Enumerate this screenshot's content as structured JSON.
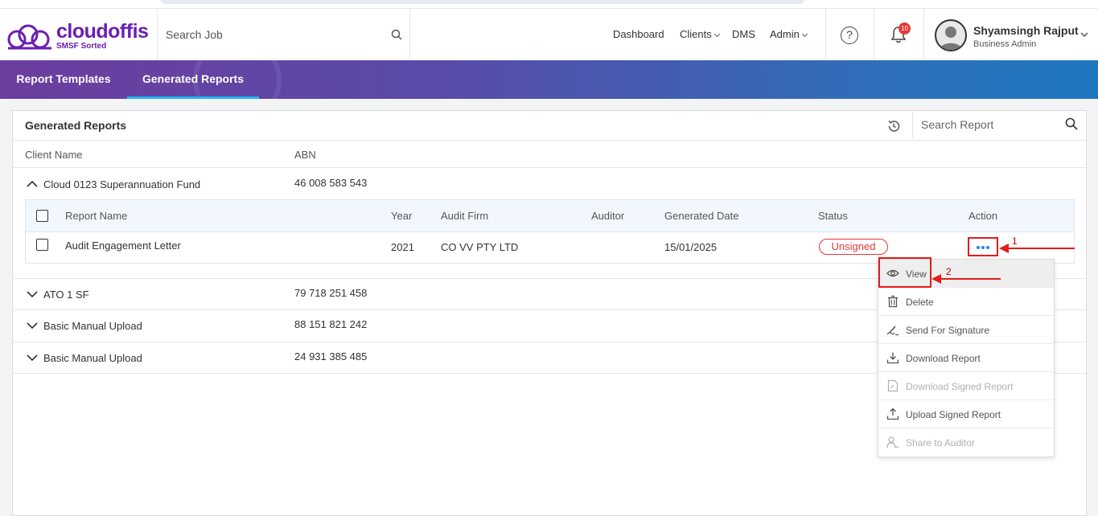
{
  "brand": {
    "name": "cloudoffis",
    "tagline": "SMSF Sorted",
    "color": "#6a1fb0"
  },
  "header": {
    "search_placeholder": "Search Job",
    "nav": [
      "Dashboard",
      "Clients",
      "DMS",
      "Admin"
    ],
    "notifications_count": "10",
    "user_name": "Shyamsingh Rajput",
    "user_role": "Business Admin"
  },
  "tabs": [
    {
      "label": "Report Templates",
      "active": false
    },
    {
      "label": "Generated Reports",
      "active": true
    }
  ],
  "panel": {
    "title": "Generated Reports",
    "search_placeholder": "Search Report",
    "columns": [
      "Client Name",
      "ABN"
    ],
    "clients": [
      {
        "name": "Cloud 0123 Superannuation Fund",
        "abn": "46 008 583 543",
        "expanded": true
      },
      {
        "name": "ATO 1 SF",
        "abn": "79 718 251 458",
        "expanded": false
      },
      {
        "name": "Basic Manual Upload",
        "abn": "88 151 821 242",
        "expanded": false
      },
      {
        "name": "Basic Manual Upload",
        "abn": "24 931 385 485",
        "expanded": false
      }
    ],
    "report_columns": [
      "Report Name",
      "Year",
      "Audit Firm",
      "Auditor",
      "Generated Date",
      "Status",
      "Action"
    ],
    "report_row": {
      "name": "Audit Engagement Letter",
      "year": "2021",
      "audit_firm": "CO VV PTY LTD",
      "auditor": "",
      "generated_date": "15/01/2025",
      "status": "Unsigned"
    }
  },
  "action_menu": [
    {
      "label": "View",
      "icon": "eye-icon",
      "enabled": true
    },
    {
      "label": "Delete",
      "icon": "trash-icon",
      "enabled": true
    },
    {
      "label": "Send For Signature",
      "icon": "signature-icon",
      "enabled": true
    },
    {
      "label": "Download Report",
      "icon": "download-icon",
      "enabled": true
    },
    {
      "label": "Download Signed Report",
      "icon": "signed-file-icon",
      "enabled": false
    },
    {
      "label": "Upload Signed Report",
      "icon": "upload-icon",
      "enabled": true
    },
    {
      "label": "Share to Auditor",
      "icon": "share-user-icon",
      "enabled": false
    }
  ],
  "annotations": [
    "1",
    "2"
  ],
  "colors": {
    "status_unsigned": "#e53935",
    "annotation": "#e31c1c",
    "tab_indicator": "#21b5f0"
  }
}
